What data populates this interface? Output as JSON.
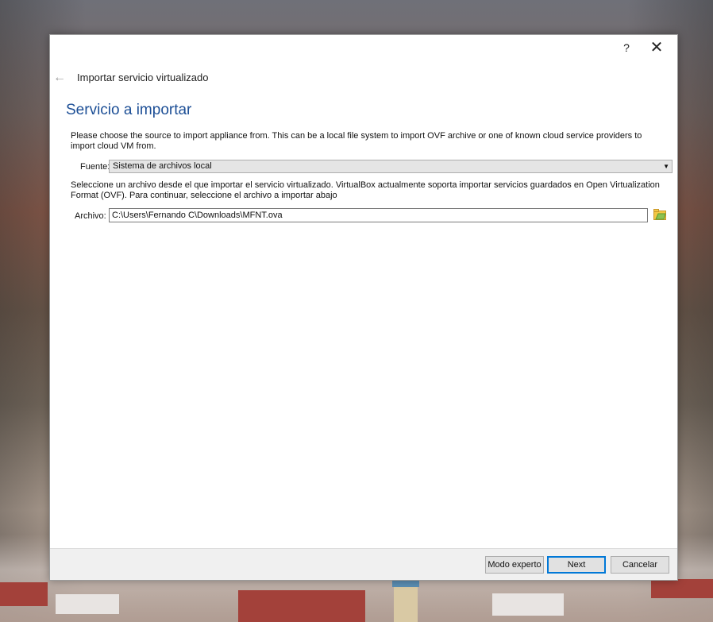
{
  "window": {
    "help_glyph": "?",
    "close_glyph": "✕"
  },
  "header": {
    "back_glyph": "←",
    "wizard_title": "Importar servicio virtualizado",
    "page_title": "Servicio a importar"
  },
  "main": {
    "source_description": "Please choose the source to import appliance from. This can be a local file system to import OVF archive or one of known cloud service providers to import cloud VM from.",
    "source_label": "Fuente:",
    "source_value": "Sistema de archivos local",
    "file_description": "Seleccione un archivo desde el que importar el servicio virtualizado. VirtualBox actualmente soporta importar servicios guardados en Open Virtualization Format (OVF). Para continuar, seleccione el archivo a importar abajo",
    "file_label": "Archivo:",
    "file_value": "C:\\Users\\Fernando C\\Downloads\\MFNT.ova"
  },
  "footer": {
    "expert_label": "Modo experto",
    "next_label": "Next",
    "cancel_label": "Cancelar"
  },
  "colors": {
    "title_blue": "#1d4f96",
    "accent": "#0078d7",
    "folder_yellow": "#f2c744"
  }
}
